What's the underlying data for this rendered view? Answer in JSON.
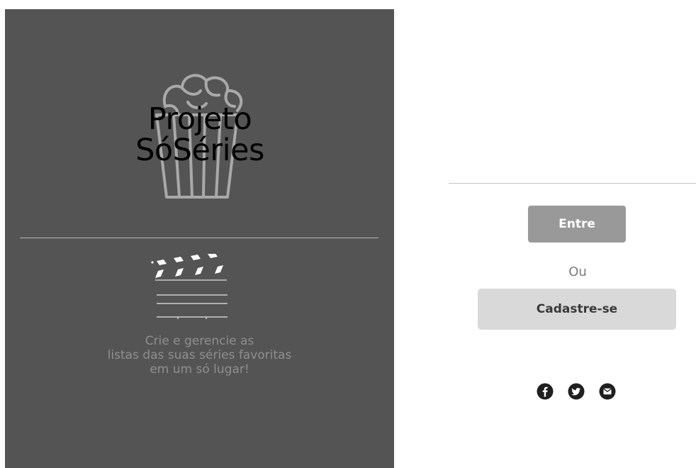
{
  "brand": {
    "title_line1": "Projeto",
    "title_line2": "SóSéries"
  },
  "tagline": {
    "line1": "Crie e gerencie as",
    "line2": "listas das suas séries favoritas",
    "line3": "em um só lugar!"
  },
  "auth": {
    "login_label": "Entre",
    "or_label": "Ou",
    "signup_label": "Cadastre-se"
  },
  "social": [
    {
      "name": "facebook",
      "icon": "facebook-icon"
    },
    {
      "name": "twitter",
      "icon": "twitter-icon"
    },
    {
      "name": "email",
      "icon": "mail-icon"
    }
  ],
  "colors": {
    "left_panel_bg": "#545454",
    "login_button_bg": "#999999",
    "signup_button_bg": "#d9d9d9"
  }
}
